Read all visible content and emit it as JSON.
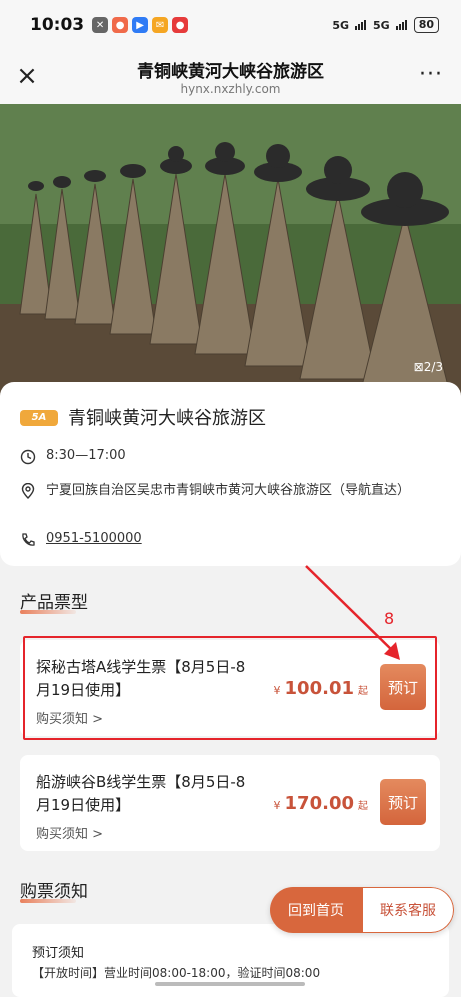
{
  "status_bar": {
    "time": "10:03",
    "signal_1": "5G",
    "signal_2": "5G",
    "battery": "80"
  },
  "titlebar": {
    "title": "青铜峡黄河大峡谷旅游区",
    "subtitle": "hynx.nxzhly.com",
    "more": "···"
  },
  "hero": {
    "image_counter": "2/3"
  },
  "info": {
    "badge": "5A",
    "name": "青铜峡黄河大峡谷旅游区",
    "hours": "8:30—17:00",
    "address": "宁夏回族自治区吴忠市青铜峡市黄河大峡谷旅游区（导航直达）",
    "phone": "0951-5100000"
  },
  "products": {
    "section_title": "产品票型",
    "tickets": [
      {
        "name": "探秘古塔A线学生票【8月5日-8月19日使用】",
        "notice": "购买须知 >",
        "currency": "¥",
        "price": "100.01",
        "suffix": "起",
        "book_label": "预订"
      },
      {
        "name": "船游峡谷B线学生票【8月5日-8月19日使用】",
        "notice": "购买须知 >",
        "currency": "¥",
        "price": "170.00",
        "suffix": "起",
        "book_label": "预订"
      }
    ]
  },
  "annotation": {
    "number": "8",
    "color": "#e5242b"
  },
  "purchase_notice": {
    "section_title": "购票须知",
    "heading": "预订须知",
    "line": "【开放时间】营业时间08:00-18:00，验证时间08:00"
  },
  "floating": {
    "home_label": "回到首页",
    "service_label": "联系客服"
  },
  "colors": {
    "accent": "#d8673d",
    "price": "#c8533a"
  }
}
